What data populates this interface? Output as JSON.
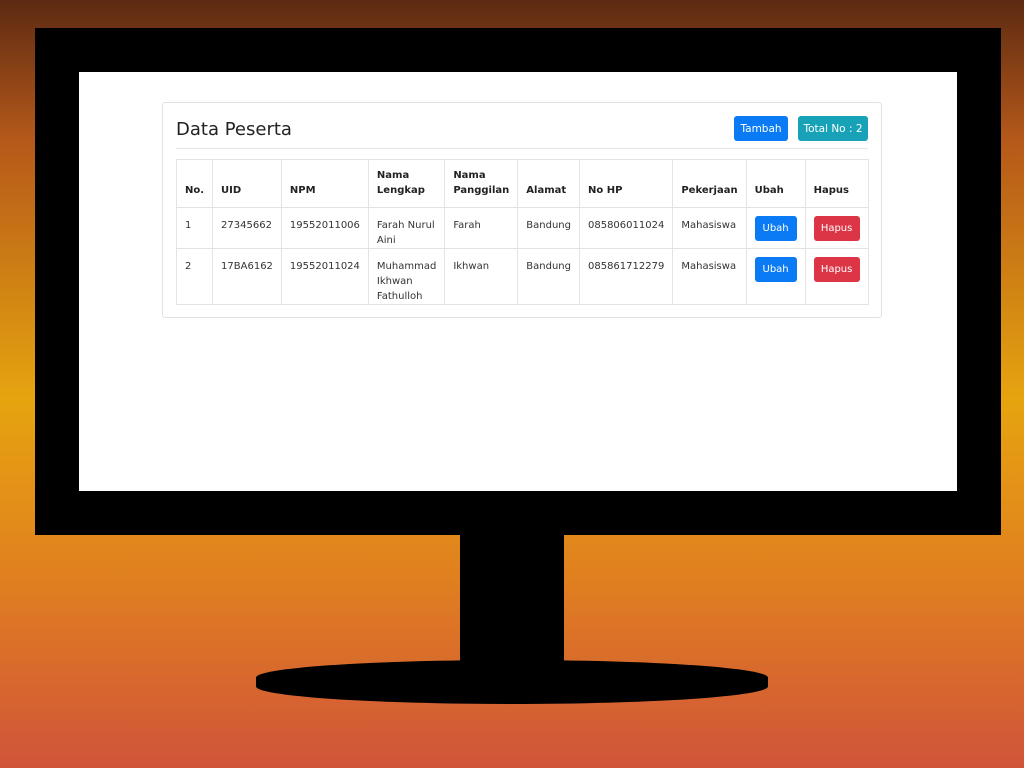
{
  "card": {
    "title": "Data Peserta",
    "add_button": "Tambah",
    "total_badge": "Total No : 2"
  },
  "table": {
    "headers": [
      "No.",
      "UID",
      "NPM",
      "Nama Lengkap",
      "Nama Panggilan",
      "Alamat",
      "No HP",
      "Pekerjaan",
      "Ubah",
      "Hapus"
    ],
    "rows": [
      {
        "no": "1",
        "uid": "27345662",
        "npm": "19552011006",
        "nama_lengkap": "Farah Nurul Aini",
        "nama_panggilan": "Farah",
        "alamat": "Bandung",
        "no_hp": "085806011024",
        "pekerjaan": "Mahasiswa",
        "ubah": "Ubah",
        "hapus": "Hapus"
      },
      {
        "no": "2",
        "uid": "17BA6162",
        "npm": "19552011024",
        "nama_lengkap": "Muhammad Ikhwan Fathulloh",
        "nama_panggilan": "Ikhwan",
        "alamat": "Bandung",
        "no_hp": "085861712279",
        "pekerjaan": "Mahasiswa",
        "ubah": "Ubah",
        "hapus": "Hapus"
      }
    ]
  },
  "colors": {
    "primary": "#0b7bf5",
    "info": "#18a2b8",
    "danger": "#dc3545"
  }
}
